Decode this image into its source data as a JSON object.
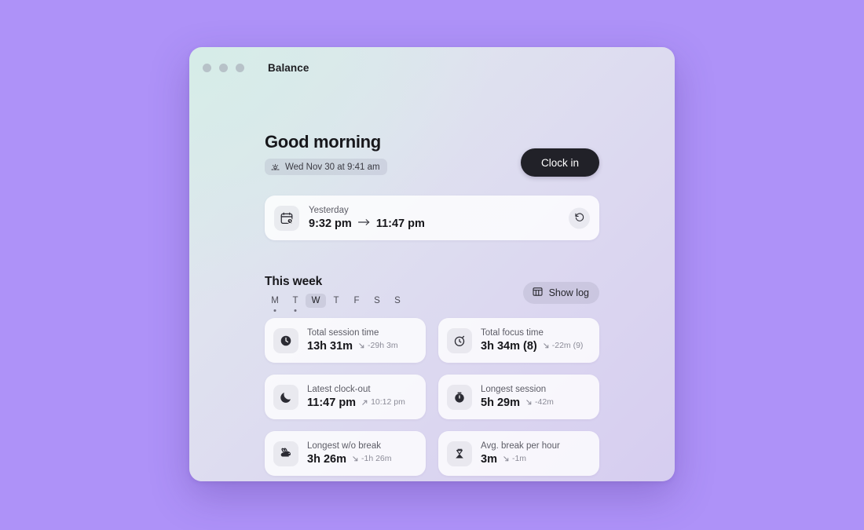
{
  "window": {
    "app_title": "Balance",
    "traffic_lights": [
      "close-dot",
      "minimize-dot",
      "maximize-dot"
    ]
  },
  "header": {
    "greeting": "Good morning",
    "date_badge": {
      "icon": "sunrise-icon",
      "text": "Wed Nov 30 at 9:41 am"
    },
    "clock_in_label": "Clock in"
  },
  "session_card": {
    "icon": "calendar-clock-icon",
    "label": "Yesterday",
    "start_time": "9:32 pm",
    "arrow": "→",
    "end_time": "11:47 pm",
    "restart_icon": "restart-counterclockwise-icon"
  },
  "week": {
    "title": "This week",
    "show_log_label": "Show log",
    "show_log_icon": "table-grid-icon",
    "days": [
      {
        "letter": "M",
        "active": false,
        "dot": true
      },
      {
        "letter": "T",
        "active": false,
        "dot": true
      },
      {
        "letter": "W",
        "active": true,
        "dot": false
      },
      {
        "letter": "T",
        "active": false,
        "dot": false
      },
      {
        "letter": "F",
        "active": false,
        "dot": false
      },
      {
        "letter": "S",
        "active": false,
        "dot": false
      },
      {
        "letter": "S",
        "active": false,
        "dot": false
      }
    ]
  },
  "stats": [
    {
      "icon": "clock-filled-icon",
      "label": "Total session time",
      "value": "13h 31m",
      "delta": "-29h 3m",
      "trend": "down"
    },
    {
      "icon": "stopwatch-outline-icon",
      "label": "Total focus time",
      "value": "3h 34m (8)",
      "delta": "-22m (9)",
      "trend": "down"
    },
    {
      "icon": "moon-icon",
      "label": "Latest clock-out",
      "value": "11:47 pm",
      "delta": "10:12 pm",
      "trend": "up"
    },
    {
      "icon": "stopwatch-filled-icon",
      "label": "Longest session",
      "value": "5h 29m",
      "delta": "-42m",
      "trend": "down"
    },
    {
      "icon": "rabbit-icon",
      "label": "Longest w/o break",
      "value": "3h 26m",
      "delta": "-1h 26m",
      "trend": "down"
    },
    {
      "icon": "hourglass-sand-icon",
      "label": "Avg. break per hour",
      "value": "3m",
      "delta": "-1m",
      "trend": "down"
    }
  ],
  "colors": {
    "desktop_background": "#ae92f8",
    "clock_in_button": "#212128",
    "card_surface": "#ffffff",
    "text_primary": "#16161a",
    "text_secondary": "#5c5c66",
    "text_muted": "#8c8c98"
  }
}
